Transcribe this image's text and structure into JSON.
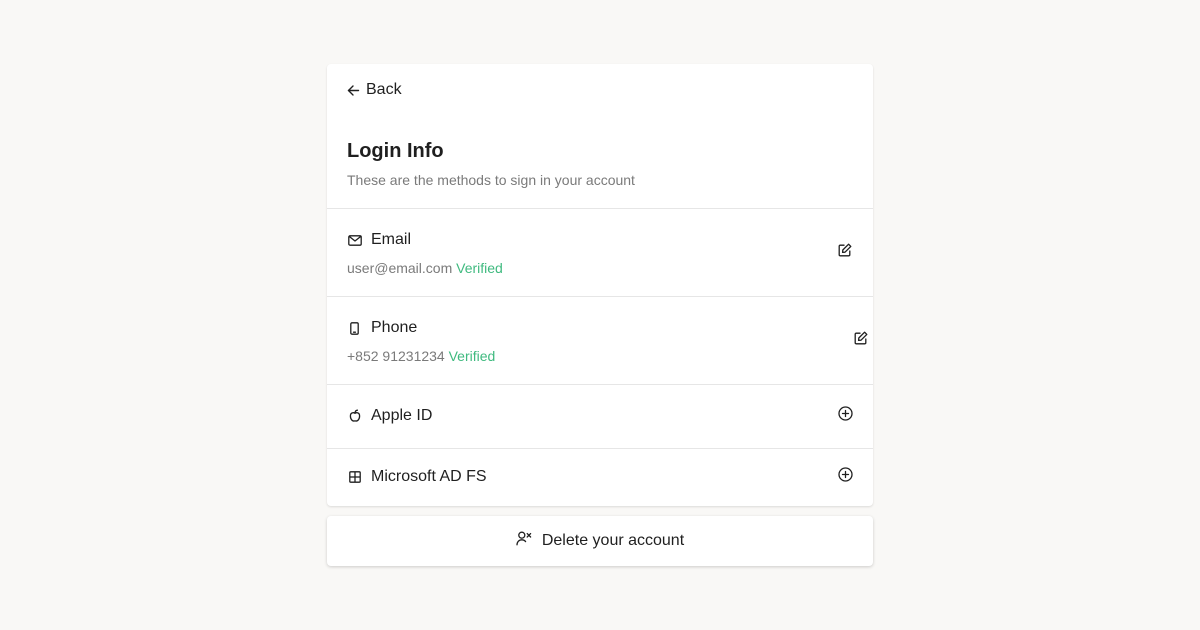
{
  "back": {
    "label": "Back",
    "icon": "arrow-left-icon"
  },
  "header": {
    "title": "Login Info",
    "subtitle": "These are the methods to sign in your account"
  },
  "methods": [
    {
      "icon": "mail-icon",
      "label": "Email",
      "value": "user@email.com",
      "status": "Verified",
      "action": "edit-icon"
    },
    {
      "icon": "smartphone-icon",
      "label": "Phone",
      "value": "+852 91231234",
      "status": "Verified",
      "action": "edit-icon"
    },
    {
      "icon": "apple-icon",
      "label": "Apple ID",
      "action": "add-circle-icon"
    },
    {
      "icon": "microsoft-icon",
      "label": "Microsoft AD FS",
      "action": "add-circle-icon"
    }
  ],
  "delete": {
    "label": "Delete your account",
    "icon": "user-remove-icon"
  },
  "colors": {
    "background": "#f9f8f6",
    "card": "#ffffff",
    "verified": "#3fba7f",
    "muted_text": "#7a7a7a",
    "divider": "#e6e6e6"
  }
}
